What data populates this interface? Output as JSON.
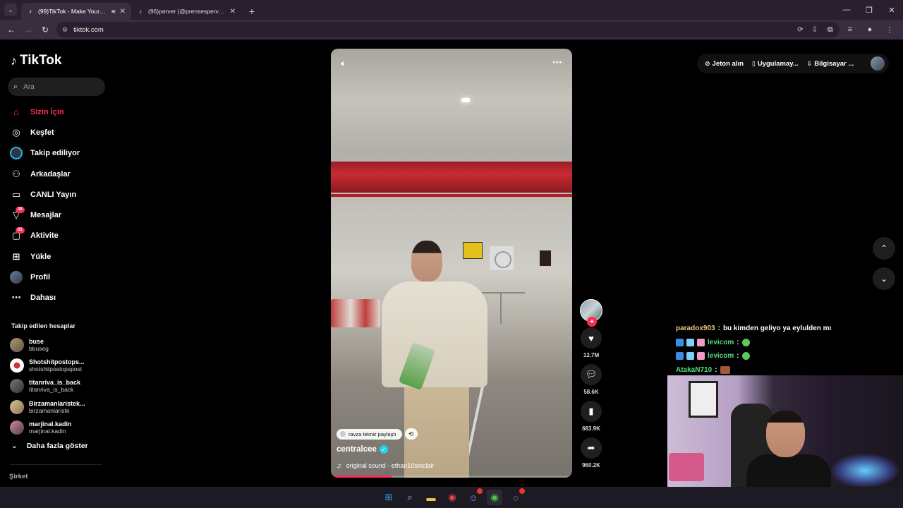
{
  "browser": {
    "tabs": [
      {
        "title": "(99)TikTok - Make Your Day",
        "active": true
      },
      {
        "title": "(96)perver (@prensesperver) | T",
        "active": false
      }
    ],
    "url": "tiktok.com"
  },
  "tiktok": {
    "logo": "TikTok",
    "search": {
      "placeholder": "Ara"
    },
    "menu": [
      {
        "label": "Sizin İçin",
        "icon": "home-icon"
      },
      {
        "label": "Keşfet",
        "icon": "compass-icon"
      },
      {
        "label": "Takip ediliyor",
        "icon": "following-icon"
      },
      {
        "label": "Arkadaşlar",
        "icon": "friends-icon"
      },
      {
        "label": "CANLI Yayın",
        "icon": "live-icon"
      },
      {
        "label": "Mesajlar",
        "icon": "messages-icon",
        "badge": "38"
      },
      {
        "label": "Aktivite",
        "icon": "activity-icon",
        "badge": "61"
      },
      {
        "label": "Yükle",
        "icon": "upload-icon"
      },
      {
        "label": "Profil",
        "icon": "profile-avatar"
      },
      {
        "label": "Dahası",
        "icon": "more-icon"
      }
    ],
    "following_title": "Takip edilen hesaplar",
    "following": [
      {
        "name": "buse",
        "user": "bbuseg"
      },
      {
        "name": "Shotshitpostops...",
        "user": "shotshitpostopspost"
      },
      {
        "name": "titanriva_is_back",
        "user": "titanriva_is_back"
      },
      {
        "name": "Birzamanlaristek...",
        "user": "birzamanlariste"
      },
      {
        "name": "marjinal.kadin",
        "user": "marjinal.kadin"
      }
    ],
    "show_more": "Daha fazla göster",
    "company": "Şirket",
    "topbar": {
      "coins": "Jeton alın",
      "app": "Uygulamay...",
      "desktop": "Bilgisayar ..."
    }
  },
  "video": {
    "repost_text": "ravza tekrar paylaştı",
    "author": "centralcee",
    "sound": "original sound - ethan10sinclair",
    "progress": 0.25
  },
  "actions": {
    "likes": "12.7M",
    "comments": "58.6K",
    "saves": "683.9K",
    "shares": "960.2K"
  },
  "chat": [
    {
      "user": "paradox903",
      "message": "bu kimden geliyo ya eylulden mı"
    },
    {
      "user": "levicom",
      "message": ""
    },
    {
      "user": "levicom",
      "message": ""
    },
    {
      "user": "AtakaN710",
      "message": ""
    }
  ]
}
